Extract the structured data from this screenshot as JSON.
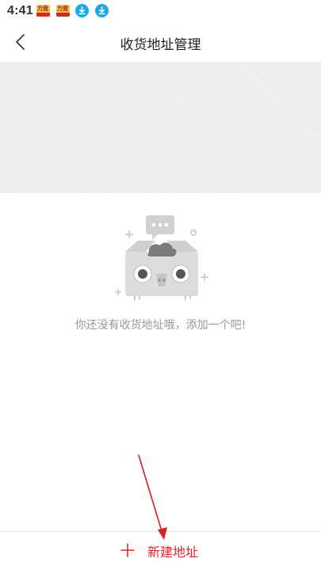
{
  "status_bar": {
    "time": "4:41",
    "icons": [
      "app-badge-icon",
      "app-badge-icon",
      "download-icon",
      "download-icon"
    ]
  },
  "header": {
    "title": "收货地址管理",
    "back_icon": "chevron-left-icon"
  },
  "empty_state": {
    "message": "你还没有收货地址哦，添加一个吧!",
    "illustration": "empty-box-mascot-icon"
  },
  "footer": {
    "add_button_label": "新建地址",
    "add_icon": "plus-icon"
  },
  "colors": {
    "accent": "#e5262c",
    "banner": "#f0f0f0",
    "empty_text": "#999999",
    "download_badge": "#1ea8e8",
    "annotation_arrow": "#d42020"
  }
}
